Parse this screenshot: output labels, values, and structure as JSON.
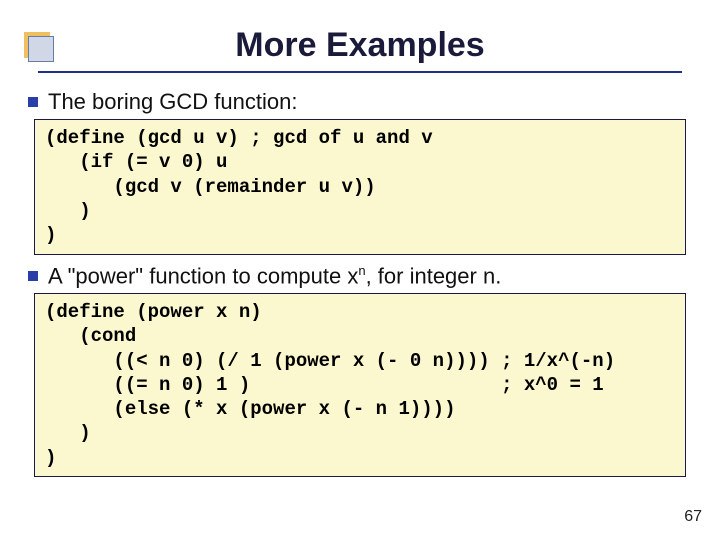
{
  "title": "More Examples",
  "intro1": "The boring GCD function:",
  "code1": "(define (gcd u v) ; gcd of u and v\n   (if (= v 0) u\n      (gcd v (remainder u v))\n   )\n)",
  "intro2_pre": "A \"power\" function to compute x",
  "intro2_sup": "n",
  "intro2_post": ", for integer n.",
  "code2": "(define (power x n)\n   (cond\n      ((< n 0) (/ 1 (power x (- 0 n)))) ; 1/x^(-n)\n      ((= n 0) 1 )                      ; x^0 = 1\n      (else (* x (power x (- n 1))))\n   )\n)",
  "page_number": "67"
}
